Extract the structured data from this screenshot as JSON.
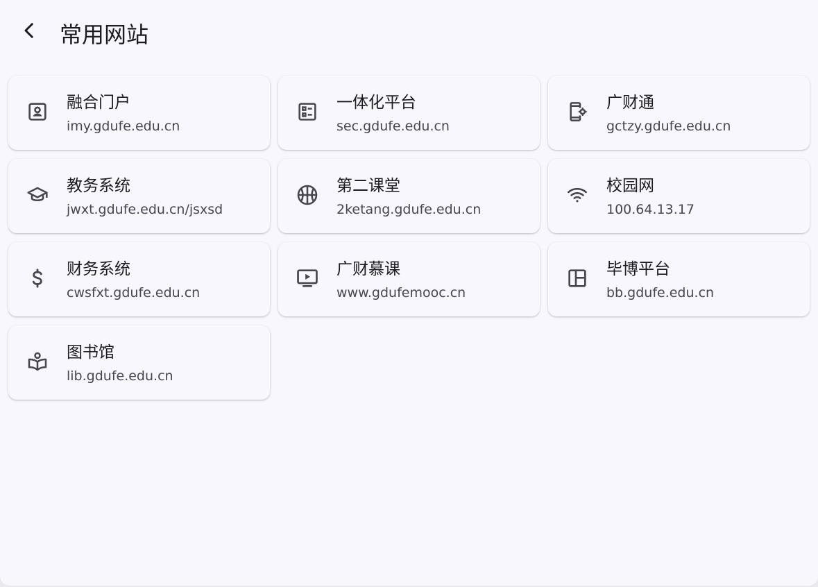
{
  "header": {
    "title": "常用网站",
    "back_icon": "arrow-back-icon"
  },
  "sites": [
    {
      "name": "融合门户",
      "url": "imy.gdufe.edu.cn",
      "icon": "portrait-icon"
    },
    {
      "name": "一体化平台",
      "url": "sec.gdufe.edu.cn",
      "icon": "list-alt-icon"
    },
    {
      "name": "广财通",
      "url": "gctzy.gdufe.edu.cn",
      "icon": "phone-settings-icon"
    },
    {
      "name": "教务系统",
      "url": "jwxt.gdufe.edu.cn/jsxsd",
      "icon": "school-icon"
    },
    {
      "name": "第二课堂",
      "url": "2ketang.gdufe.edu.cn",
      "icon": "sports-basketball-icon"
    },
    {
      "name": "校园网",
      "url": "100.64.13.17",
      "icon": "wifi-icon"
    },
    {
      "name": "财务系统",
      "url": "cwsfxt.gdufe.edu.cn",
      "icon": "dollar-icon"
    },
    {
      "name": "广财慕课",
      "url": "www.gdufemooc.cn",
      "icon": "video-play-icon"
    },
    {
      "name": "毕博平台",
      "url": "bb.gdufe.edu.cn",
      "icon": "dashboard-layout-icon"
    },
    {
      "name": "图书馆",
      "url": "lib.gdufe.edu.cn",
      "icon": "local-library-icon"
    }
  ],
  "colors": {
    "background": "#f8f7fd",
    "text_primary": "#1c1b20",
    "text_secondary": "#47464f",
    "icon": "#46464f"
  }
}
